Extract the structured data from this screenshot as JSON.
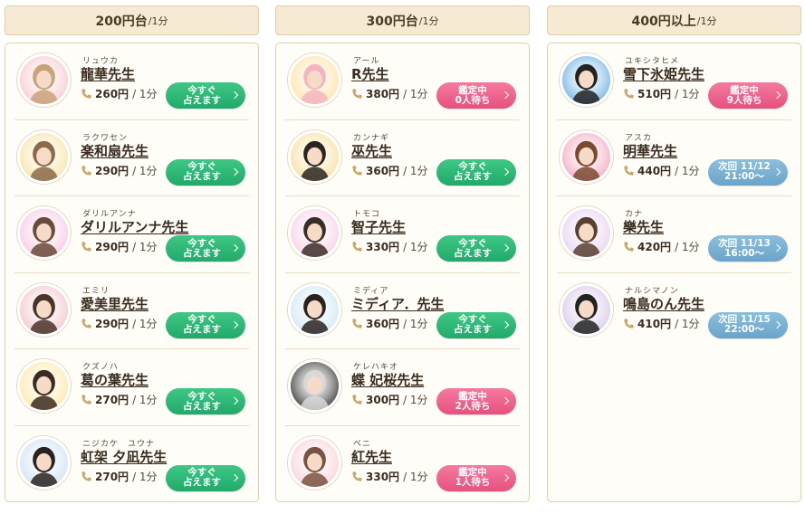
{
  "columns": [
    {
      "header": {
        "price_range": "200円台",
        "per": "/1分"
      },
      "fortunetellers": [
        {
          "kana": "リュウカ",
          "name": "龍華先生",
          "price": "260円",
          "per_min": "/ 1分",
          "status_line1": "今すぐ",
          "status_line2": "占えます",
          "status": "available"
        },
        {
          "kana": "ラクワセン",
          "name": "楽和扇先生",
          "price": "290円",
          "per_min": "/ 1分",
          "status_line1": "今すぐ",
          "status_line2": "占えます",
          "status": "available"
        },
        {
          "kana": "ダリルアンナ",
          "name": "ダリルアンナ先生",
          "price": "290円",
          "per_min": "/ 1分",
          "status_line1": "今すぐ",
          "status_line2": "占えます",
          "status": "available"
        },
        {
          "kana": "エミリ",
          "name": "愛美里先生",
          "price": "290円",
          "per_min": "/ 1分",
          "status_line1": "今すぐ",
          "status_line2": "占えます",
          "status": "available"
        },
        {
          "kana": "クズノハ",
          "name": "葛の葉先生",
          "price": "270円",
          "per_min": "/ 1分",
          "status_line1": "今すぐ",
          "status_line2": "占えます",
          "status": "available"
        },
        {
          "kana": "ニジカケ　ユウナ",
          "name": "虹架 夕凪先生",
          "price": "270円",
          "per_min": "/ 1分",
          "status_line1": "今すぐ",
          "status_line2": "占えます",
          "status": "available"
        }
      ]
    },
    {
      "header": {
        "price_range": "300円台",
        "per": "/1分"
      },
      "fortunetellers": [
        {
          "kana": "アール",
          "name": "R先生",
          "price": "380円",
          "per_min": "/ 1分",
          "status_line1": "鑑定中",
          "status_line2": "0人待ち",
          "status": "busy"
        },
        {
          "kana": "カンナギ",
          "name": "巫先生",
          "price": "360円",
          "per_min": "/ 1分",
          "status_line1": "今すぐ",
          "status_line2": "占えます",
          "status": "available"
        },
        {
          "kana": "トモコ",
          "name": "智子先生",
          "price": "330円",
          "per_min": "/ 1分",
          "status_line1": "今すぐ",
          "status_line2": "占えます",
          "status": "available"
        },
        {
          "kana": "ミディア",
          "name": "ミディア．先生",
          "price": "360円",
          "per_min": "/ 1分",
          "status_line1": "今すぐ",
          "status_line2": "占えます",
          "status": "available"
        },
        {
          "kana": "ケレハキオ",
          "name": "蝶 妃桜先生",
          "price": "300円",
          "per_min": "/ 1分",
          "status_line1": "鑑定中",
          "status_line2": "2人待ち",
          "status": "busy"
        },
        {
          "kana": "ベニ",
          "name": "紅先生",
          "price": "330円",
          "per_min": "/ 1分",
          "status_line1": "鑑定中",
          "status_line2": "1人待ち",
          "status": "busy"
        }
      ]
    },
    {
      "header": {
        "price_range": "400円以上",
        "per": "/1分"
      },
      "fortunetellers": [
        {
          "kana": "ユキシタヒメ",
          "name": "雪下氷姫先生",
          "price": "510円",
          "per_min": "/ 1分",
          "status_line1": "鑑定中",
          "status_line2": "9人待ち",
          "status": "busy"
        },
        {
          "kana": "アスカ",
          "name": "明華先生",
          "price": "440円",
          "per_min": "/ 1分",
          "status_line1": "次回 11/12",
          "status_line2": "21:00〜",
          "status": "scheduled"
        },
        {
          "kana": "カナ",
          "name": "樂先生",
          "price": "420円",
          "per_min": "/ 1分",
          "status_line1": "次回 11/13",
          "status_line2": "16:00〜",
          "status": "scheduled"
        },
        {
          "kana": "ナルシマノン",
          "name": "鳴島のん先生",
          "price": "410円",
          "per_min": "/ 1分",
          "status_line1": "次回 11/15",
          "status_line2": "22:00〜",
          "status": "scheduled"
        }
      ]
    }
  ],
  "colors": {
    "available": "#22a96b",
    "busy": "#e6517e",
    "scheduled": "#6aa4c8",
    "header_bg": "#f6ead4",
    "border": "#e2cfa6"
  },
  "icons": {
    "price_icon": "phone-icon",
    "button_icon": "chevron-right-icon"
  }
}
